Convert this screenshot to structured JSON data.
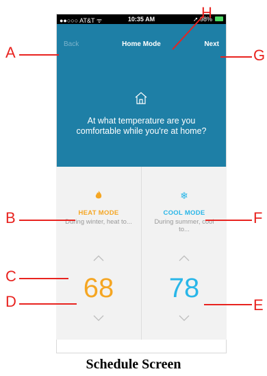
{
  "status_bar": {
    "carrier": "●●○○○ AT&T ᯤ",
    "time": "10:35 AM",
    "battery": "➚ 98%"
  },
  "nav": {
    "back_label": "Back",
    "title": "Home Mode",
    "next_label": "Next"
  },
  "prompt": {
    "question": "At what temperature are you comfortable while you're at home?"
  },
  "heat": {
    "title": "HEAT MODE",
    "description": "During winter, heat to...",
    "temperature": "68",
    "color": "#f5a623"
  },
  "cool": {
    "title": "COOL MODE",
    "description": "During summer, cool to...",
    "temperature": "78",
    "color": "#29b6e8"
  },
  "annotations": {
    "a": "A",
    "b": "B",
    "c": "C",
    "d": "D",
    "e": "E",
    "f": "F",
    "g": "G",
    "h": "H"
  },
  "caption": "Schedule Screen",
  "colors": {
    "header_blue": "#1e7fa6",
    "annotation_red": "#e8231f"
  }
}
